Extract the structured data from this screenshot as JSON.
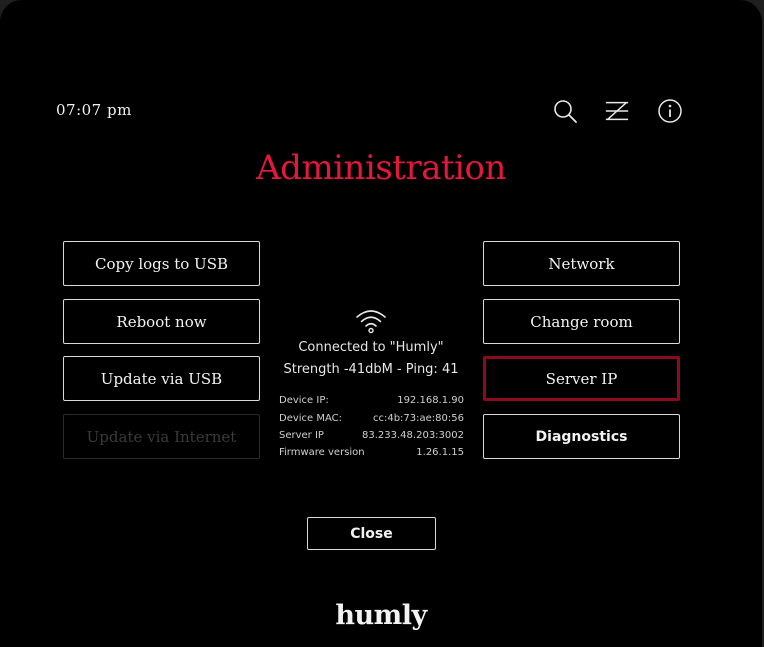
{
  "header": {
    "time": "07:07 pm",
    "icons": [
      "search-icon",
      "no-network-icon",
      "info-icon"
    ]
  },
  "title": "Administration",
  "left_buttons": {
    "copy_logs": "Copy logs to USB",
    "reboot": "Reboot now",
    "update_usb": "Update via USB",
    "update_internet": "Update via Internet"
  },
  "right_buttons": {
    "network": "Network",
    "change_room": "Change room",
    "server_ip": "Server IP",
    "diagnostics": "Diagnostics"
  },
  "connection": {
    "status": "Connected to \"Humly\"",
    "strength": "Strength -41dbM - Ping: 41"
  },
  "device_info": [
    {
      "label": "Device IP:",
      "value": "192.168.1.90"
    },
    {
      "label": "Device MAC:",
      "value": "cc:4b:73:ae:80:56"
    },
    {
      "label": "Server IP",
      "value": "83.233.48.203:3002"
    },
    {
      "label": "Firmware version",
      "value": "1.26.1.15"
    }
  ],
  "close_label": "Close",
  "brand": "humly",
  "colors": {
    "accent": "#e4173c",
    "selected_border": "#8b0b1c",
    "background": "#000000"
  }
}
